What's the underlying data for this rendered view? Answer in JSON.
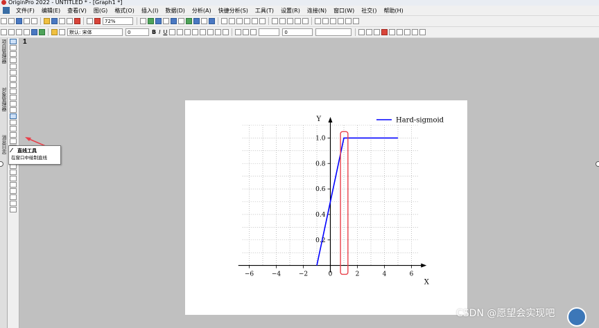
{
  "window": {
    "title": "OriginPro 2022 - UNTITLED * - [Graph1 *]"
  },
  "menu": [
    "文件(F)",
    "编辑(E)",
    "查看(V)",
    "图(G)",
    "格式(O)",
    "插入(I)",
    "数据(D)",
    "分析(A)",
    "快捷分析(S)",
    "工具(T)",
    "设置(R)",
    "连接(N)",
    "窗口(W)",
    "社交()",
    "帮助(H)"
  ],
  "toolbar": {
    "zoom": "72%",
    "font_name": "默认: 宋体",
    "font_size": "0",
    "line_width": "0",
    "bold": "B",
    "italic": "I",
    "underline": "U"
  },
  "side_tabs": [
    "项目管理器",
    "对象管理器",
    "消息日志"
  ],
  "layer_number": "1",
  "tooltip": {
    "title": "直线工具",
    "description": "在窗口中绘制直线"
  },
  "watermark": "CSDN @愿望会实现吧",
  "colors": {
    "curve": "#0000ff",
    "highlight": "#e8404a",
    "page": "#ffffff",
    "workspace": "#c0c0c0"
  },
  "chart_data": {
    "type": "line",
    "series": [
      {
        "name": "Hard-sigmoid",
        "x": [
          -1,
          1,
          5
        ],
        "y": [
          0,
          1,
          1
        ]
      }
    ],
    "xlabel": "X",
    "ylabel": "Y",
    "xlim": [
      -7,
      7
    ],
    "ylim": [
      -0.1,
      1.1
    ],
    "xticks": [
      -6,
      -4,
      -2,
      0,
      2,
      4,
      6
    ],
    "yticks": [
      0.2,
      0.4,
      0.6,
      0.8,
      1.0
    ],
    "xtick_labels": [
      "−6",
      "−4",
      "−2",
      "0",
      "2",
      "4",
      "6"
    ],
    "ytick_labels": [
      "0.2",
      "0.4",
      "0.6",
      "0.8",
      "1.0"
    ],
    "grid": true,
    "legend": "top-right",
    "annotation": {
      "type": "highlight-rect",
      "x_range": [
        0.75,
        1.3
      ],
      "y_range": [
        -0.07,
        1.05
      ]
    }
  }
}
